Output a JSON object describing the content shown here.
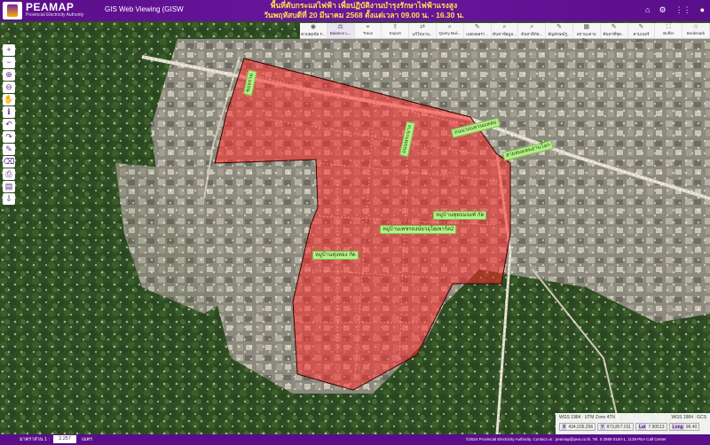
{
  "header": {
    "brand": "PEAMAP",
    "brand_sub": "Provincial Electricity Authority",
    "app_title": "GIS Web Viewing (GISW",
    "announce_line1": "พื้นที่ดับกระแสไฟฟ้า เพื่อปฏิบัติงานบำรุงรักษาไฟฟ้าแรงสูง",
    "announce_line2": "วันพฤหัสบดีที่ 20 มีนาคม 2568 ตั้งแต่เวลา 09.00 น. - 16.30 น.",
    "icons": [
      "home-icon",
      "gear-icon",
      "grid-icon",
      "user-icon"
    ]
  },
  "toolbar": [
    {
      "icon": "◉",
      "label": "ควบคุมข้อ F...",
      "name": "tool-control"
    },
    {
      "icon": "⚖",
      "label": "Balance L...",
      "name": "tool-balance",
      "active": true
    },
    {
      "icon": "⌖",
      "label": "Trace",
      "name": "tool-trace"
    },
    {
      "icon": "⇪",
      "label": "Export",
      "name": "tool-export"
    },
    {
      "icon": "⇄",
      "label": "แก้ไขบวน...",
      "name": "tool-edit"
    },
    {
      "icon": "⌕",
      "label": "Query Buil...",
      "name": "tool-query-builder"
    },
    {
      "icon": "✎",
      "label": "แสดงผลรา...",
      "name": "tool-display"
    },
    {
      "icon": "⌕",
      "label": "ค้นหาข้อมูล...",
      "name": "tool-search"
    },
    {
      "icon": "⌕",
      "label": "ค้นหาพิกัด...",
      "name": "tool-search-coord"
    },
    {
      "icon": "✎",
      "label": "สัญลักษณ์รู...",
      "name": "tool-symbols"
    },
    {
      "icon": "▦",
      "label": "สถานะตามใน...",
      "name": "tool-status"
    },
    {
      "icon": "✎",
      "label": "ค้นหาที่ชุด...",
      "name": "tool-find-area"
    },
    {
      "icon": "✎",
      "label": "ตามเบอร์มอน...",
      "name": "tool-meter"
    },
    {
      "icon": "⛶",
      "label": "Buffer",
      "name": "tool-buffer"
    },
    {
      "icon": "☆",
      "label": "Bookmark",
      "name": "tool-bookmark"
    }
  ],
  "map_labels": [
    {
      "text": "ถนนวงแหวนแหลม",
      "name": "label-road-north",
      "style": "d"
    },
    {
      "text": "ซอยราม",
      "name": "label-soi-ram",
      "style": "v"
    },
    {
      "text": "ถนนพระนาง",
      "name": "label-road-vertical",
      "style": "v"
    },
    {
      "text": "สายสมดสมอ่านโลก",
      "name": "label-line-east",
      "style": "d"
    },
    {
      "text": "หมู่บ้านพุทธมณฑ์ กัด",
      "name": "label-village-1",
      "style": "h"
    },
    {
      "text": "หมู่บ้านเพชรหงษ์ยวอุโฒพาร์ค2",
      "name": "label-village-2",
      "style": "h"
    },
    {
      "text": "หมู่บ้านทุ่งทอง กัด",
      "name": "label-village-3",
      "style": "h"
    }
  ],
  "coords": {
    "wgs_utm": "WGS 1984 : UTM Zone 47N",
    "wgs_gcs": "WGS 1984 : GCS",
    "x_label": "X",
    "x_value": "434,035.256",
    "y_label": "Y",
    "y_value": "873,857.011",
    "lat_label": "Lat",
    "lat_value": "7.90513",
    "long_label": "Long",
    "long_value": "98.40"
  },
  "footer": {
    "scale_label": "มาตราส่วน 1 :",
    "scale_value": "2,257",
    "scale_unit": "เมตร",
    "copyright": "©2024 Provincial Electricity Authority. Contact us : peamap@pea.co.th, Tel. 0 2589 0100-1, 1129 PEA Call Center"
  },
  "colors": {
    "header": "#5a0e8a",
    "outage_fill": "#ff2a2a",
    "label_bg": "#b7f08a"
  }
}
